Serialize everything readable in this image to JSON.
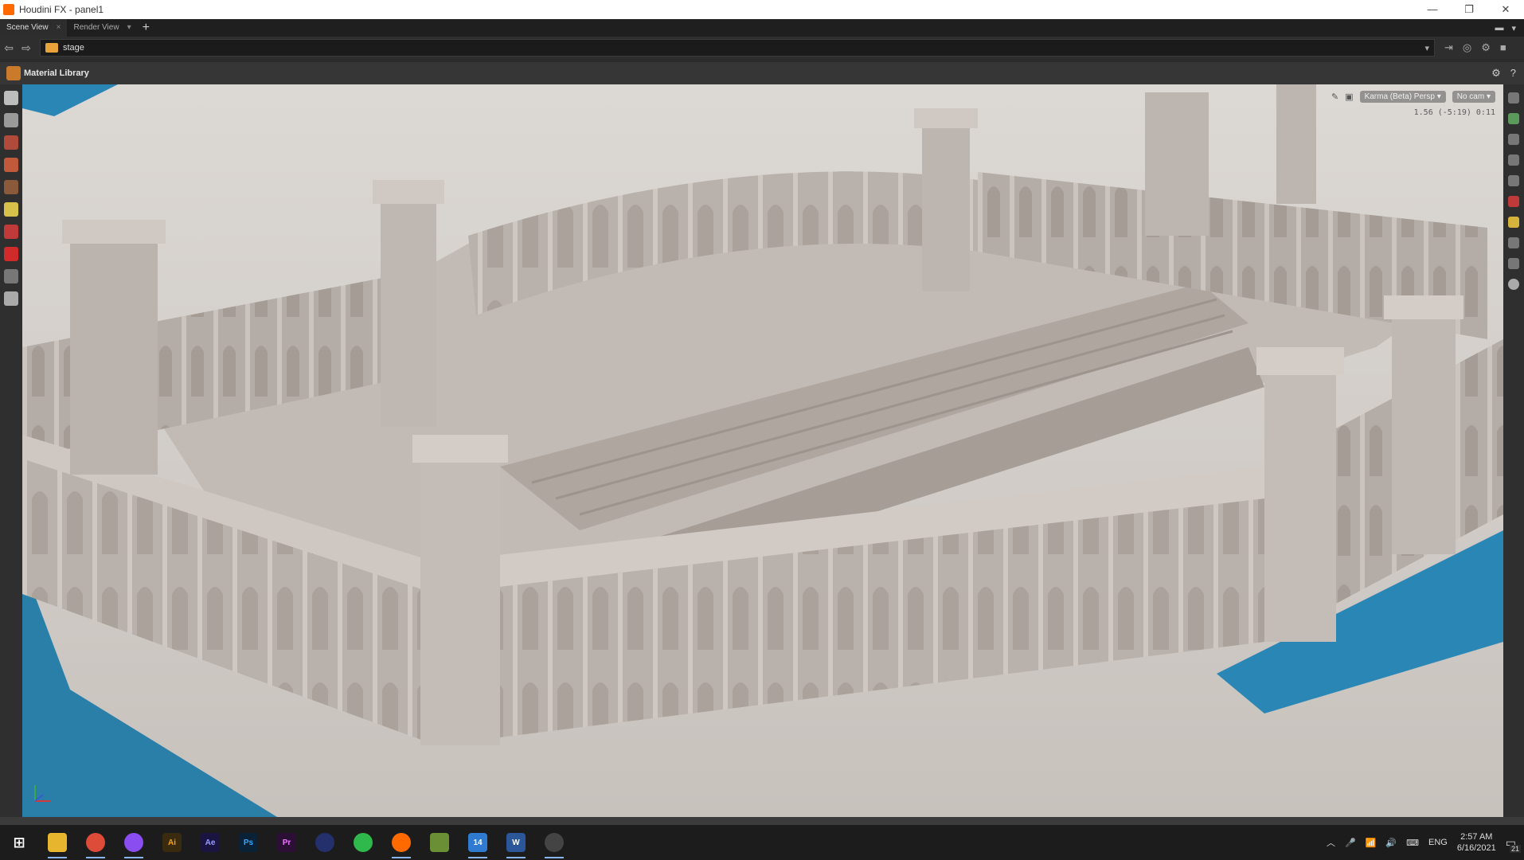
{
  "window": {
    "title": "Houdini FX - panel1",
    "controls": [
      "—",
      "❐",
      "✕"
    ]
  },
  "tabs": [
    {
      "label": "Scene View",
      "active": true
    },
    {
      "label": "Render View",
      "active": false
    }
  ],
  "path": {
    "value": "stage"
  },
  "panel": {
    "title": "Material Library"
  },
  "viewport": {
    "renderer": "Karma (Beta) Persp ▾",
    "camera": "No cam ▾",
    "stats": "1.56   (-5:19)   0:11"
  },
  "taskbar": {
    "apps": [
      {
        "name": "start-icon",
        "label": "⊞",
        "color": "#1c1c1c"
      },
      {
        "name": "file-explorer-icon",
        "label": "",
        "color": "#e8b62e"
      },
      {
        "name": "chrome-icon",
        "label": "",
        "color": "#dd4b39"
      },
      {
        "name": "messenger-icon",
        "label": "",
        "color": "#8a4df0"
      },
      {
        "name": "illustrator-icon",
        "label": "Ai",
        "color": "#3a2a10"
      },
      {
        "name": "after-effects-icon",
        "label": "Ae",
        "color": "#1a1540"
      },
      {
        "name": "photoshop-icon",
        "label": "Ps",
        "color": "#0b2236"
      },
      {
        "name": "premiere-icon",
        "label": "Pr",
        "color": "#2b0f35"
      },
      {
        "name": "cinema4d-icon",
        "label": "",
        "color": "#24306b"
      },
      {
        "name": "whatsapp-icon",
        "label": "",
        "color": "#2fb84c"
      },
      {
        "name": "houdini-icon",
        "label": "",
        "color": "#ff6a00"
      },
      {
        "name": "app-icon",
        "label": "",
        "color": "#6b8f35"
      },
      {
        "name": "explorer-window-icon",
        "label": "14",
        "color": "#2f7bd2"
      },
      {
        "name": "word-icon",
        "label": "W",
        "color": "#2b579a"
      },
      {
        "name": "obs-icon",
        "label": "",
        "color": "#444444"
      }
    ],
    "language": "ENG",
    "time": "2:57 AM",
    "date": "6/16/2021",
    "notifications": "21"
  }
}
